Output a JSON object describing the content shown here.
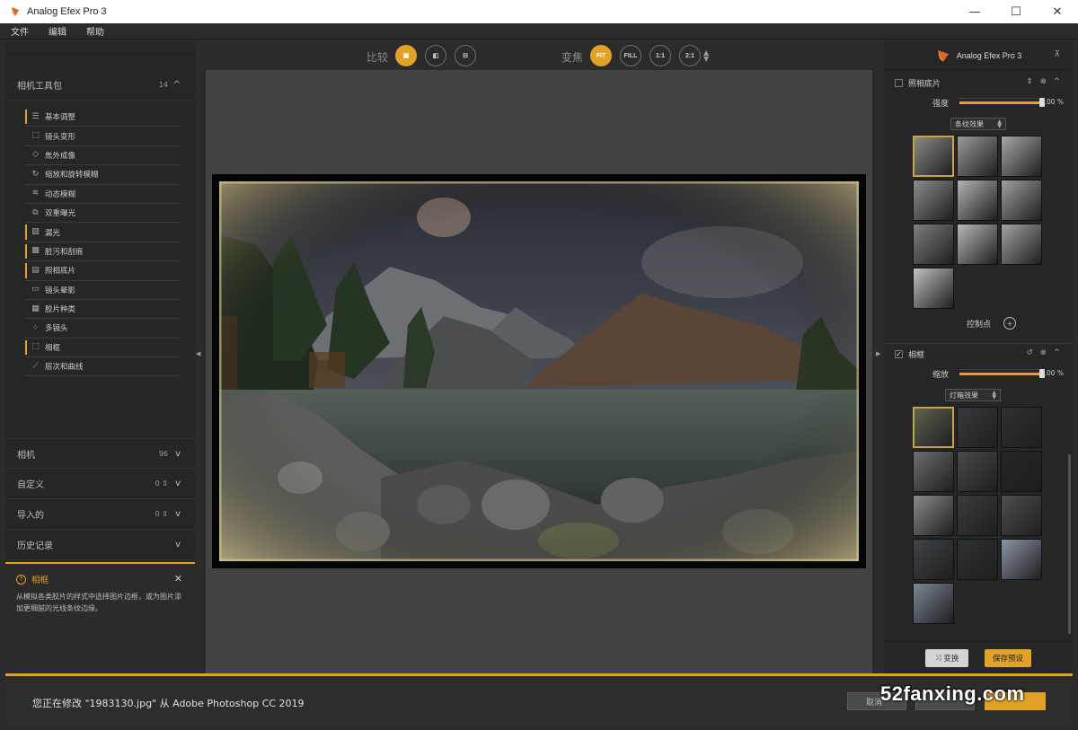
{
  "window": {
    "title": "Analog Efex Pro 3",
    "minimize": "—",
    "maximize": "☐",
    "close": "✕"
  },
  "menu": [
    "文件",
    "编辑",
    "帮助"
  ],
  "left": {
    "toolkit": {
      "title": "相机工具包",
      "count": "14",
      "chevron": "^"
    },
    "tools": [
      {
        "label": "基本调整",
        "icon": "sliders-icon",
        "glyph": "☰",
        "active": true
      },
      {
        "label": "镜头变形",
        "icon": "lens-distortion-icon",
        "glyph": "⬚",
        "active": false
      },
      {
        "label": "焦外成像",
        "icon": "bokeh-icon",
        "glyph": "◇",
        "active": false
      },
      {
        "label": "缩放和旋转模糊",
        "icon": "zoom-rotate-blur-icon",
        "glyph": "↻",
        "active": false
      },
      {
        "label": "动态模糊",
        "icon": "motion-blur-icon",
        "glyph": "≋",
        "active": false
      },
      {
        "label": "双重曝光",
        "icon": "double-exposure-icon",
        "glyph": "⧉",
        "active": false
      },
      {
        "label": "漏光",
        "icon": "light-leak-icon",
        "glyph": "▨",
        "active": true
      },
      {
        "label": "脏污和刮痕",
        "icon": "dirt-scratch-icon",
        "glyph": "▩",
        "active": true
      },
      {
        "label": "照相底片",
        "icon": "film-plate-icon",
        "glyph": "▤",
        "active": true
      },
      {
        "label": "镜头晕影",
        "icon": "vignette-icon",
        "glyph": "▭",
        "active": false
      },
      {
        "label": "胶片种类",
        "icon": "film-type-icon",
        "glyph": "▦",
        "active": false
      },
      {
        "label": "多镜头",
        "icon": "multi-lens-icon",
        "glyph": "⁘",
        "active": false
      },
      {
        "label": "相框",
        "icon": "frame-icon",
        "glyph": "⬚",
        "active": true
      },
      {
        "label": "层次和曲线",
        "icon": "curves-icon",
        "glyph": "⟋",
        "active": false
      }
    ],
    "sections": [
      {
        "label": "相机",
        "count": "96",
        "chevron": "v"
      },
      {
        "label": "自定义",
        "count": "0 ⇕",
        "chevron": "v"
      },
      {
        "label": "导入的",
        "count": "0 ⇕",
        "chevron": "v"
      },
      {
        "label": "历史记录",
        "count": "",
        "chevron": "v"
      }
    ],
    "help": {
      "title": "相框",
      "icon_glyph": "?",
      "close": "✕",
      "text": "从模拟各类胶片的样式中选择图片边框，或为图片添加更细腻的光线条纹边缘。"
    }
  },
  "toolbar": {
    "compare_label": "比较",
    "zoom_label": "变焦",
    "compare_buttons": [
      {
        "name": "compare-single-view-button",
        "glyph": "▣",
        "on": true
      },
      {
        "name": "compare-split-view-button",
        "glyph": "◧",
        "on": false
      },
      {
        "name": "compare-side-by-side-button",
        "glyph": "⊟",
        "on": false
      }
    ],
    "zoom_buttons": [
      {
        "name": "zoom-fit-button",
        "label": "FIT",
        "on": true
      },
      {
        "name": "zoom-fill-button",
        "label": "FILL",
        "on": false
      },
      {
        "name": "zoom-1-1-button",
        "label": "1:1",
        "on": false
      },
      {
        "name": "zoom-2-1-button",
        "label": "2:1",
        "on": false
      }
    ],
    "zoom_updown": "▲▼"
  },
  "right": {
    "brand": "Analog Efex Pro 3",
    "collapse": "⊼",
    "film_plate": {
      "title": "照相底片",
      "checked": false,
      "strength_label": "强度",
      "strength_value": "100 %",
      "strength_fraction": 1.0,
      "preset": "条纹效果",
      "thumbs": 10,
      "control_points_label": "控制点",
      "control_points_glyph": "+"
    },
    "frame": {
      "title": "相框",
      "checked": true,
      "check_glyph": "✓",
      "scale_label": "缩放",
      "scale_value": "100 %",
      "scale_fraction": 1.0,
      "preset": "灯箱效果",
      "thumbs": 13
    },
    "actions_glyphs": {
      "updown": "⇕",
      "reset": "↺",
      "delete": "⊗",
      "collapse": "^"
    },
    "swap_label": "变换",
    "swap_glyph": "⤨",
    "save_preset_label": "保存预设"
  },
  "bottom": {
    "status": "您正在修改 \"1983130.jpg\" 从 Adobe Photoshop CC 2019",
    "cancel_label": "取消"
  },
  "watermark": "52fanxing.com",
  "colors": {
    "accent": "#e0a227",
    "panel": "#262626",
    "canvas": "#434343"
  }
}
